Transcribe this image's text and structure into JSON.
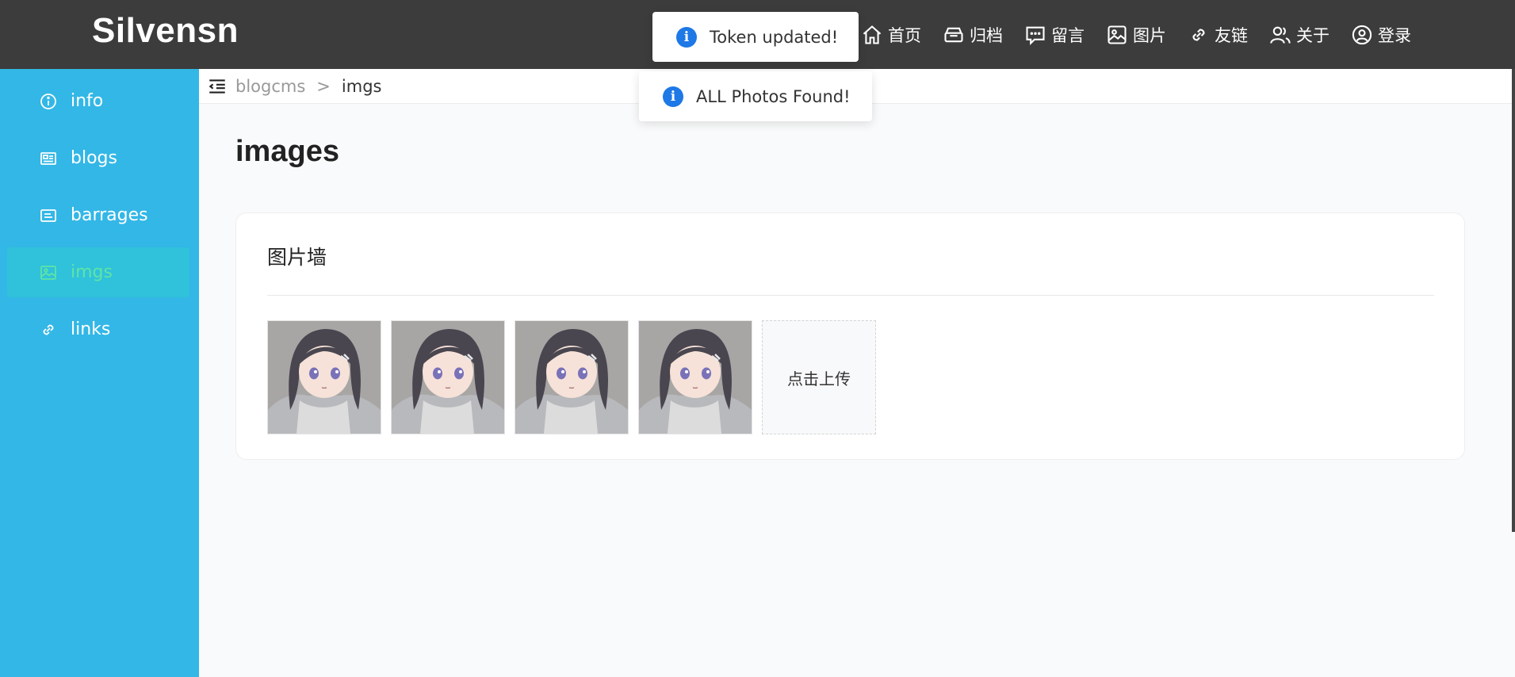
{
  "header": {
    "logo": "Silvensn",
    "nav": [
      {
        "label": "首页",
        "icon": "home-icon"
      },
      {
        "label": "归档",
        "icon": "archive-icon"
      },
      {
        "label": "留言",
        "icon": "message-icon"
      },
      {
        "label": "图片",
        "icon": "image-icon"
      },
      {
        "label": "友链",
        "icon": "link-icon"
      },
      {
        "label": "关于",
        "icon": "users-icon"
      },
      {
        "label": "登录",
        "icon": "user-circle-icon"
      }
    ]
  },
  "sidebar": {
    "items": [
      {
        "label": "info",
        "icon": "info-icon"
      },
      {
        "label": "blogs",
        "icon": "newspaper-icon"
      },
      {
        "label": "barrages",
        "icon": "barrage-icon"
      },
      {
        "label": "imgs",
        "icon": "image-icon",
        "active": true
      },
      {
        "label": "links",
        "icon": "link-icon"
      }
    ]
  },
  "breadcrumb": {
    "parent": "blogcms",
    "separator": ">",
    "current": "imgs"
  },
  "main": {
    "title": "images",
    "card_title": "图片墙",
    "photos": [
      {
        "alt": "anime-girl-photo"
      },
      {
        "alt": "anime-girl-photo"
      },
      {
        "alt": "anime-girl-photo"
      },
      {
        "alt": "anime-girl-photo"
      }
    ],
    "upload_label": "点击上传"
  },
  "toasts": [
    {
      "text": "Token updated!",
      "icon": "info-icon"
    },
    {
      "text": "ALL Photos Found!",
      "icon": "info-icon"
    }
  ],
  "colors": {
    "topbar": "#3c3c3c",
    "sidebar": "#33b7e6",
    "sidebar_active_bg": "#2fc2da",
    "sidebar_active_text": "#5ee4a6",
    "info_blue": "#1e78e6"
  }
}
